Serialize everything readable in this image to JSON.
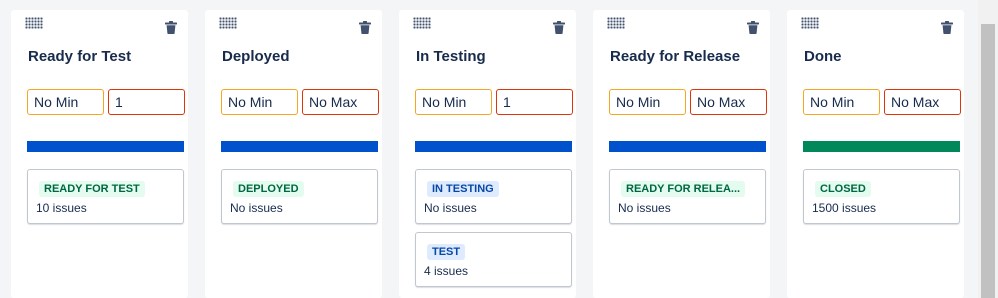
{
  "columns": [
    {
      "title": "Ready for Test",
      "min_value": "No Min",
      "max_value": "1",
      "bar_color": "#0052cc",
      "statuses": [
        {
          "label": "READY FOR TEST",
          "count": "10 issues",
          "color": "green"
        }
      ]
    },
    {
      "title": "Deployed",
      "min_value": "No Min",
      "max_value": "No Max",
      "bar_color": "#0052cc",
      "statuses": [
        {
          "label": "DEPLOYED",
          "count": "No issues",
          "color": "green"
        }
      ]
    },
    {
      "title": "In Testing",
      "min_value": "No Min",
      "max_value": "1",
      "bar_color": "#0052cc",
      "statuses": [
        {
          "label": "IN TESTING",
          "count": "No issues",
          "color": "blue"
        },
        {
          "label": "TEST",
          "count": "4 issues",
          "color": "blue"
        }
      ]
    },
    {
      "title": "Ready for Release",
      "min_value": "No Min",
      "max_value": "No Max",
      "bar_color": "#0052cc",
      "statuses": [
        {
          "label": "READY FOR RELEA...",
          "count": "No issues",
          "color": "green"
        }
      ]
    },
    {
      "title": "Done",
      "min_value": "No Min",
      "max_value": "No Max",
      "bar_color": "#00875a",
      "statuses": [
        {
          "label": "CLOSED",
          "count": "1500 issues",
          "color": "green"
        }
      ]
    }
  ],
  "icons": {
    "drag": "drag-handle-icon",
    "delete": "trash-icon"
  }
}
